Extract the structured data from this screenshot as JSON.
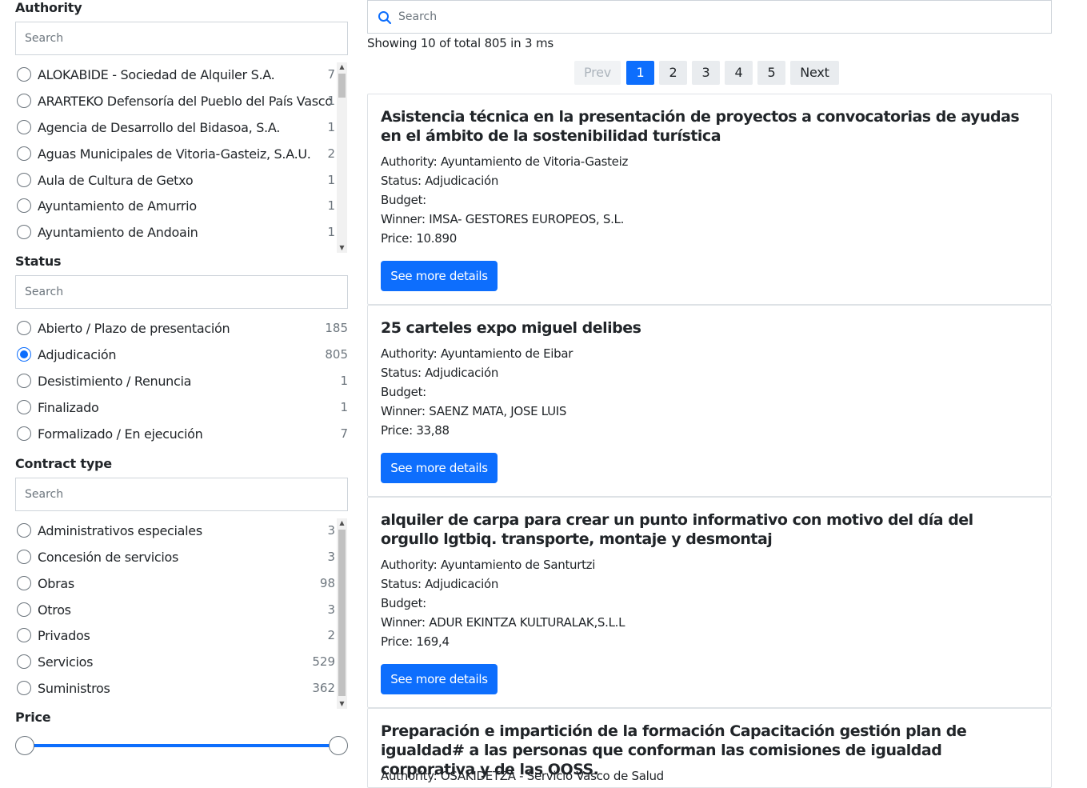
{
  "facets": {
    "authority": {
      "title": "Authority",
      "placeholder": "Search",
      "items": [
        {
          "label": "ALOKABIDE - Sociedad de Alquiler S.A.",
          "count": "7"
        },
        {
          "label": "ARARTEKO Defensoría del Pueblo del País Vasco",
          "count": "1"
        },
        {
          "label": "Agencia de Desarrollo del Bidasoa, S.A.",
          "count": "1"
        },
        {
          "label": "Aguas Municipales de Vitoria-Gasteiz, S.A.U.",
          "count": "2"
        },
        {
          "label": "Aula de Cultura de Getxo",
          "count": "1"
        },
        {
          "label": "Ayuntamiento de Amurrio",
          "count": "1"
        },
        {
          "label": "Ayuntamiento de Andoain",
          "count": "1"
        }
      ]
    },
    "status": {
      "title": "Status",
      "placeholder": "Search",
      "items": [
        {
          "label": "Abierto / Plazo de presentación",
          "count": "185",
          "checked": false
        },
        {
          "label": "Adjudicación",
          "count": "805",
          "checked": true
        },
        {
          "label": "Desistimiento / Renuncia",
          "count": "1",
          "checked": false
        },
        {
          "label": "Finalizado",
          "count": "1",
          "checked": false
        },
        {
          "label": "Formalizado / En ejecución",
          "count": "7",
          "checked": false
        }
      ]
    },
    "contract_type": {
      "title": "Contract type",
      "placeholder": "Search",
      "items": [
        {
          "label": "Administrativos especiales",
          "count": "3"
        },
        {
          "label": "Concesión de servicios",
          "count": "3"
        },
        {
          "label": "Obras",
          "count": "98"
        },
        {
          "label": "Otros",
          "count": "3"
        },
        {
          "label": "Privados",
          "count": "2"
        },
        {
          "label": "Servicios",
          "count": "529"
        },
        {
          "label": "Suministros",
          "count": "362"
        }
      ]
    },
    "price": {
      "title": "Price",
      "range_min_fraction": 0,
      "range_max_fraction": 1
    }
  },
  "search": {
    "placeholder": "Search"
  },
  "results_summary": "Showing 10 of total 805 in 3 ms",
  "pagination": {
    "prev": "Prev",
    "pages": [
      "1",
      "2",
      "3",
      "4",
      "5"
    ],
    "current": "1",
    "next": "Next"
  },
  "results": [
    {
      "title": "Asistencia técnica en la presentación de proyectos a convocatorias de ayudas en el ámbito de la sostenibilidad turística",
      "authority": "Authority: Ayuntamiento de Vitoria-Gasteiz",
      "status": "Status: Adjudicación",
      "budget": "Budget:",
      "winner": "Winner: IMSA- GESTORES EUROPEOS, S.L.",
      "price": "Price: 10.890",
      "button": "See more details"
    },
    {
      "title": "25 carteles expo miguel delibes",
      "authority": "Authority: Ayuntamiento de Eibar",
      "status": "Status: Adjudicación",
      "budget": "Budget:",
      "winner": "Winner: SAENZ MATA, JOSE LUIS",
      "price": "Price: 33,88",
      "button": "See more details"
    },
    {
      "title": "alquiler de carpa para crear un punto informativo con motivo del día del orgullo lgtbiq. transporte, montaje y desmontaj",
      "authority": "Authority: Ayuntamiento de Santurtzi",
      "status": "Status: Adjudicación",
      "budget": "Budget:",
      "winner": "Winner: ADUR EKINTZA KULTURALAK,S.L.L",
      "price": "Price: 169,4",
      "button": "See more details"
    },
    {
      "title": "Preparación e impartición de la formación Capacitación gestión plan de igualdad# a las personas que conforman las comisiones de igualdad corporativa y de las OOSS.",
      "authority": "Authority: OSAKIDETZA - Servicio Vasco de Salud"
    }
  ],
  "colors": {
    "accent": "#0d6efd",
    "border": "#dee2e6",
    "muted": "#6c757d"
  }
}
